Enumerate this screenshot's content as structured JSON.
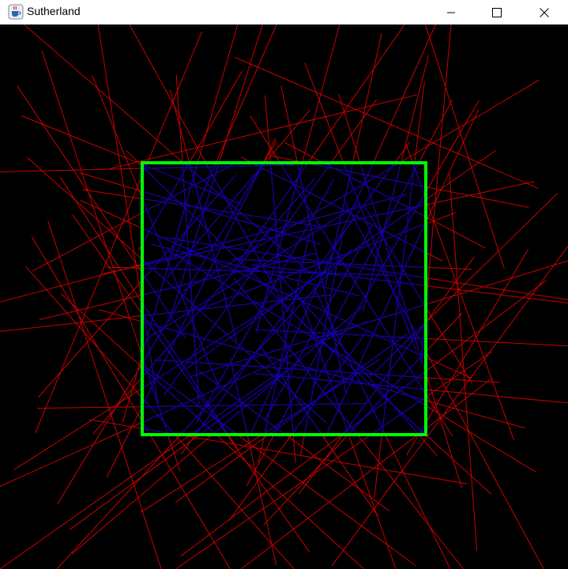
{
  "window": {
    "title": "Sutherland",
    "app_icon": "java-coffee-cup-icon",
    "controls": [
      "minimize-icon",
      "maximize-icon",
      "close-icon"
    ]
  },
  "canvas": {
    "background_color": "#000000",
    "clip_window_color": "#00ff00",
    "outside_line_color": "#cc0000",
    "inside_line_color": "#0000cc"
  }
}
